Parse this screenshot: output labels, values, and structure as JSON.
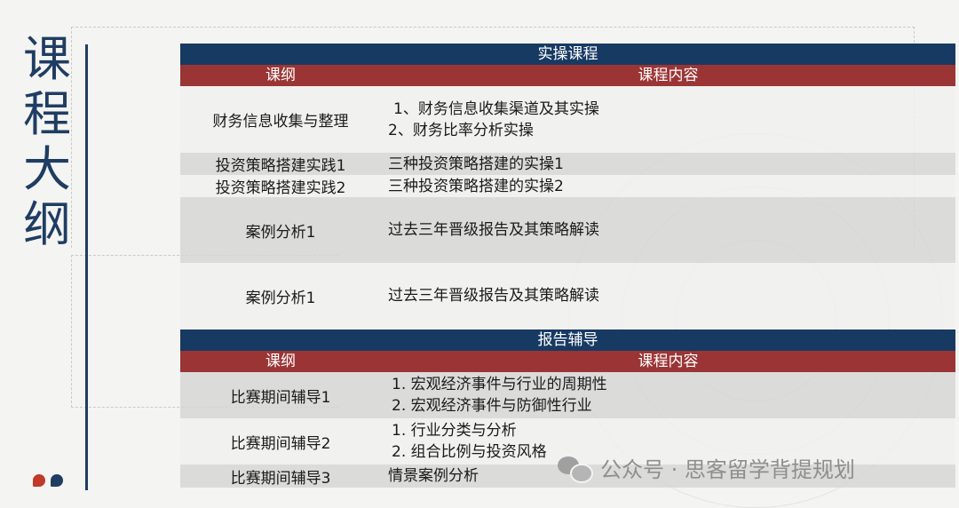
{
  "sidebar": {
    "title_chars": [
      "课",
      "程",
      "大",
      "纲"
    ]
  },
  "section1": {
    "title": "实操课程",
    "col1": "课纲",
    "col2": "课程内容",
    "rows": [
      {
        "topic": "财务信息收集与整理",
        "lines": [
          "1、财务信息收集渠道及其实操",
          "2、财务比率分析实操"
        ]
      },
      {
        "topic": "投资策略搭建实践1",
        "lines": [
          "三种投资策略搭建的实操1"
        ]
      },
      {
        "topic": "投资策略搭建实践2",
        "lines": [
          "三种投资策略搭建的实操2"
        ]
      },
      {
        "topic": "案例分析1",
        "lines": [
          "过去三年晋级报告及其策略解读"
        ]
      },
      {
        "topic": "案例分析1",
        "lines": [
          "过去三年晋级报告及其策略解读"
        ]
      }
    ]
  },
  "section2": {
    "title": "报告辅导",
    "col1": "课纲",
    "col2": "课程内容",
    "rows": [
      {
        "topic": "比赛期间辅导1",
        "lines": [
          "1. 宏观经济事件与行业的周期性",
          "2. 宏观经济事件与防御性行业"
        ]
      },
      {
        "topic": "比赛期间辅导2",
        "lines": [
          "1. 行业分类与分析",
          "2. 组合比例与投资风格"
        ]
      },
      {
        "topic": "比赛期间辅导3",
        "lines": [
          "情景案例分析"
        ]
      }
    ]
  },
  "watermark": {
    "text": "公众号 · 思客留学背提规划"
  },
  "colors": {
    "navy": "#173a63",
    "red": "#9b3535",
    "accent": "#c0392b"
  }
}
